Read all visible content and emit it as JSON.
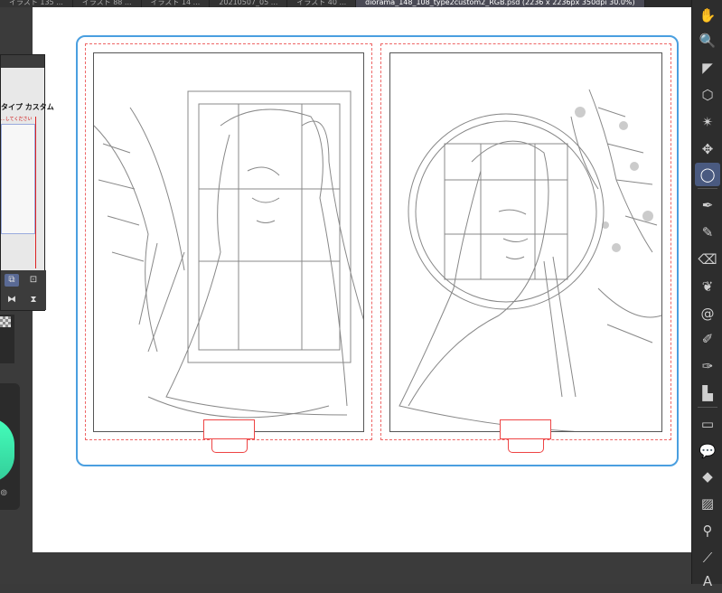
{
  "tabs": [
    {
      "label": "イラスト 135 ..."
    },
    {
      "label": "イラスト 88 ..."
    },
    {
      "label": "イラスト 14 ..."
    },
    {
      "label": "20210507_05 ..."
    },
    {
      "label": "イラスト 40 ..."
    },
    {
      "label": "diorama_148_108_type2custom2_RGB.psd (2236 x 2236px 350dpi 30.0%)"
    }
  ],
  "float_panel": {
    "title": "タイプ カスタム",
    "subtitle": "...してください"
  },
  "toolbar": {
    "tools": [
      {
        "name": "hand-icon",
        "glyph": "✋"
      },
      {
        "name": "zoom-icon",
        "glyph": "🔍"
      },
      {
        "name": "operation-icon",
        "glyph": "◤"
      },
      {
        "name": "3d-move-icon",
        "glyph": "⬡"
      },
      {
        "name": "auto-action-icon",
        "glyph": "✴"
      },
      {
        "name": "move-layer-icon",
        "glyph": "✥"
      },
      {
        "name": "lasso-selection-icon",
        "glyph": "◯"
      },
      {
        "name": "pen-icon",
        "glyph": "✒"
      },
      {
        "name": "pencil-icon",
        "glyph": "✎"
      },
      {
        "name": "eraser-icon",
        "glyph": "⌫"
      },
      {
        "name": "decoration-icon",
        "glyph": "❦"
      },
      {
        "name": "spiral-icon",
        "glyph": "@"
      },
      {
        "name": "brush-icon",
        "glyph": "✐"
      },
      {
        "name": "airbrush-icon",
        "glyph": "✑"
      },
      {
        "name": "fill-icon",
        "glyph": "▙"
      },
      {
        "name": "frame-icon",
        "glyph": "▭"
      },
      {
        "name": "balloon-icon",
        "glyph": "💬"
      },
      {
        "name": "bucket-icon",
        "glyph": "◆"
      },
      {
        "name": "gradient-icon",
        "glyph": "▨"
      },
      {
        "name": "eyedropper-icon",
        "glyph": "⚲"
      },
      {
        "name": "ruler-icon",
        "glyph": "⟋"
      },
      {
        "name": "text-icon",
        "glyph": "A"
      }
    ],
    "selected": "lasso-selection-icon"
  }
}
